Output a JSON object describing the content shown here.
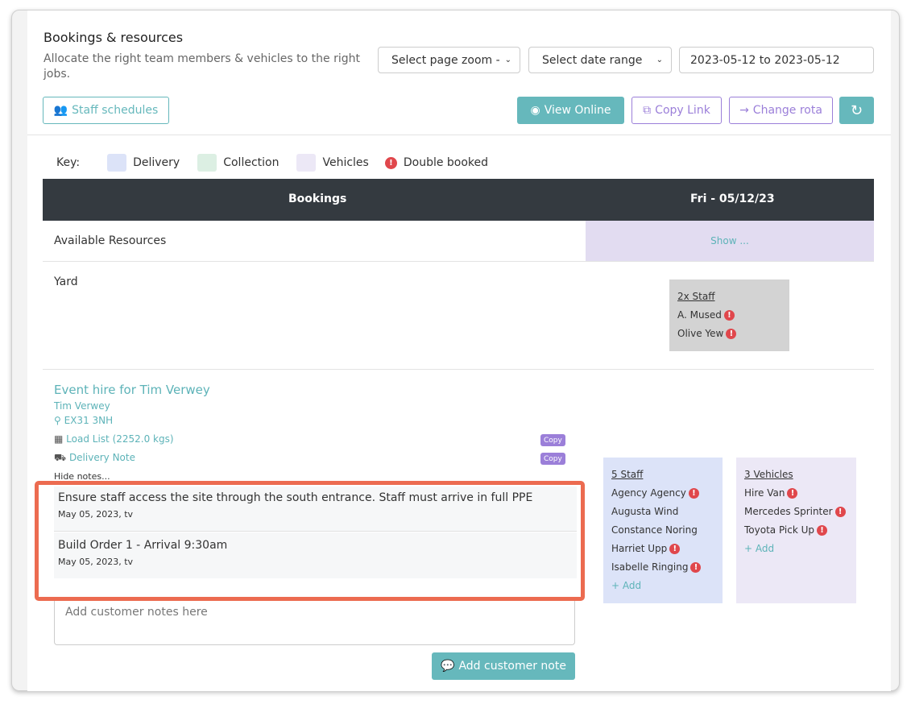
{
  "header": {
    "title": "Bookings & resources",
    "subtitle": "Allocate the right team members & vehicles to the right jobs.",
    "zoom_select": "Select page zoom -",
    "date_select": "Select date range",
    "date_value": "2023-05-12 to 2023-05-12"
  },
  "toolbar": {
    "staff_schedules": "Staff schedules",
    "view_online": "View Online",
    "copy_link": "Copy Link",
    "change_rota": "Change rota"
  },
  "key": {
    "label": "Key:",
    "items": [
      {
        "label": "Delivery",
        "color": "#dce3f8"
      },
      {
        "label": "Collection",
        "color": "#dcefe3"
      },
      {
        "label": "Vehicles",
        "color": "#ece8f6"
      }
    ],
    "double_booked": "Double booked"
  },
  "table": {
    "col1": "Bookings",
    "col2": "Fri - 05/12/23"
  },
  "available": {
    "label": "Available Resources",
    "show": "Show ..."
  },
  "yard": {
    "label": "Yard",
    "staff_title": "2x Staff",
    "staff": [
      "A. Mused",
      "Olive Yew"
    ]
  },
  "booking": {
    "title": "Event hire for Tim Verwey",
    "customer": "Tim Verwey",
    "postcode": "EX31 3NH",
    "load_list": "Load List (2252.0 kgs)",
    "delivery_note": "Delivery Note",
    "copy": "Copy",
    "hide_notes": "Hide notes...",
    "notes": [
      {
        "text": "Ensure staff access the site through the south entrance. Staff must arrive in full PPE",
        "meta": "May 05, 2023, tv"
      },
      {
        "text": "Build Order 1 - Arrival 9:30am",
        "meta": "May 05, 2023, tv"
      }
    ],
    "notes_placeholder": "Add customer notes here",
    "add_note": "Add customer note",
    "staff_title": "5 Staff",
    "staff": [
      {
        "name": "Agency Agency",
        "double": true
      },
      {
        "name": "Augusta Wind",
        "double": false
      },
      {
        "name": "Constance Noring",
        "double": false
      },
      {
        "name": "Harriet Upp",
        "double": true
      },
      {
        "name": "Isabelle Ringing",
        "double": true
      }
    ],
    "vehicles_title": "3 Vehicles",
    "vehicles": [
      {
        "name": "Hire Van",
        "double": true
      },
      {
        "name": "Mercedes Sprinter",
        "double": true
      },
      {
        "name": "Toyota Pick Up",
        "double": true
      }
    ],
    "add": "+ Add"
  },
  "colors": {
    "teal": "#66b8bc",
    "purple": "#9b7fd9",
    "error": "#e0474c",
    "highlight": "#ec6b50"
  }
}
